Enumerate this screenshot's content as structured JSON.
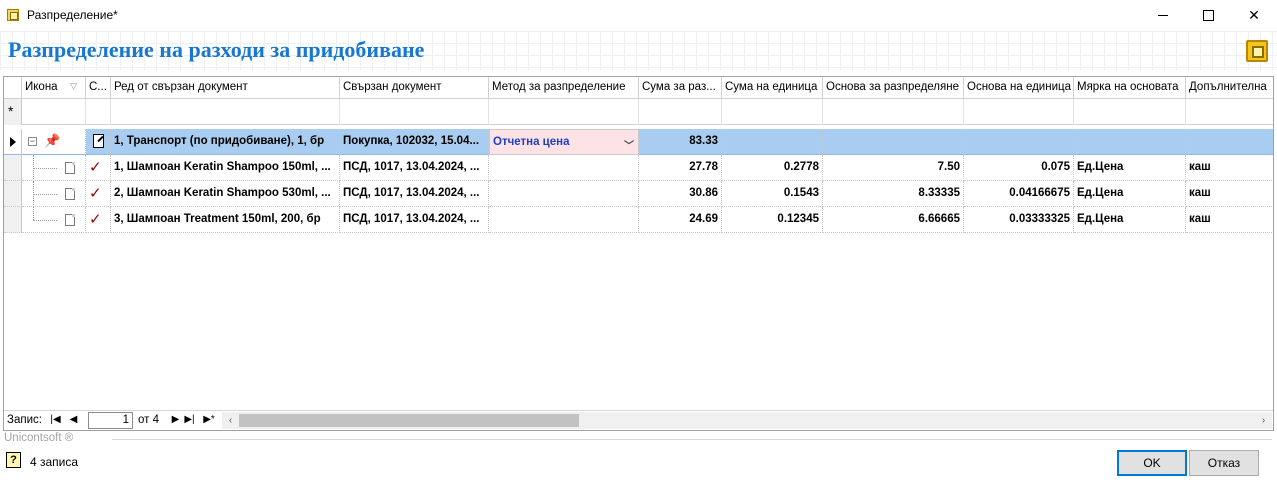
{
  "window": {
    "title": "Разпределение*"
  },
  "heading": {
    "title": "Разпределение на разходи за придобиване"
  },
  "columns": [
    "Икона",
    "С...",
    "Ред от свързан документ",
    "Свързан документ",
    "Метод за разпределение",
    "Сума за раз...",
    "Сума на единица",
    "Основа за разпределяне",
    "Основа на единица",
    "Мярка на основата",
    "Допълнителна"
  ],
  "filter_row": {
    "marker": "*"
  },
  "rows": [
    {
      "line": "1, Транспорт (по придобиване), 1, бр",
      "doc": "Покупка, 102032, 15.04...",
      "method": "Отчетна цена",
      "sum": "83.33",
      "unit_sum": "",
      "base": "",
      "unit_base": "",
      "measure": "",
      "extra": ""
    },
    {
      "line": "1, Шампоан Keratin Shampoo 150ml, ...",
      "doc": "ПСД, 1017, 13.04.2024, ...",
      "method": "",
      "sum": "27.78",
      "unit_sum": "0.2778",
      "base": "7.50",
      "unit_base": "0.075",
      "measure": "Ед.Цена",
      "extra": "каш"
    },
    {
      "line": "2, Шампоан Keratin Shampoo 530ml, ...",
      "doc": "ПСД, 1017, 13.04.2024, ...",
      "method": "",
      "sum": "30.86",
      "unit_sum": "0.1543",
      "base": "8.33335",
      "unit_base": "0.04166675",
      "measure": "Ед.Цена",
      "extra": "каш"
    },
    {
      "line": "3, Шампоан Treatment 150ml, 200, бр",
      "doc": "ПСД, 1017, 13.04.2024, ...",
      "method": "",
      "sum": "24.69",
      "unit_sum": "0.12345",
      "base": "6.66665",
      "unit_base": "0.03333325",
      "measure": "Ед.Цена",
      "extra": "каш"
    }
  ],
  "navigator": {
    "label": "Запис:",
    "current": "1",
    "of_text": "от 4"
  },
  "footer": {
    "brand": "Unicontsoft ®",
    "status": "4 записа",
    "ok_label": "OK",
    "cancel_label": "Отказ"
  },
  "colors": {
    "heading": "#1777d1",
    "selected_row": "#a9cdf0",
    "method_cell": "#fde3e6",
    "method_text": "#1c3fc4",
    "check": "#a00000"
  }
}
